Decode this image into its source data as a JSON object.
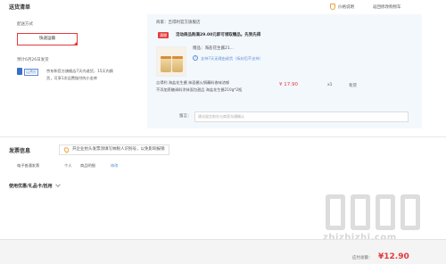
{
  "header": {
    "title": "送货清单",
    "price_help": "价格说明",
    "back_to_cart": "返回修改购物车"
  },
  "shipping": {
    "method_label": "配送方式",
    "method_chip": "快递运输",
    "eta": "预计6月26日发货",
    "tag": "运费险",
    "desc_line1": "京东和官方旗舰店7天内退货，15天内换",
    "desc_line2": "货，可享1次运费赔付的小金库"
  },
  "order": {
    "store_prefix": "商家：",
    "store_name": "吉得利官方旗舰店",
    "promo_tag": "满赠",
    "promo_text": "活动商品购满29.00元即可领取赠品。先到先得",
    "gift_label": "赠品：",
    "gift_name": "海盐花生酱21...",
    "service_tag": "7",
    "service_text": "支持7天无理由退货（拆封后不支持）",
    "product_title_line1": "吉得利 海盐花生酱 抹面酱火锅蘸料香味浓郁",
    "product_title_line2": "不添加蔗糖调料涂抹面包甜品 海盐花生酱210g*2瓶",
    "price": "¥ 17.90",
    "qty": "x1",
    "stock": "有货",
    "note_label": "留言：",
    "note_placeholder": "建议留言前先与商家沟通确认"
  },
  "invoice": {
    "title": "发票信息",
    "notice": "开企业抬头发票须填写纳税人识别号，以免影响报销",
    "type": "电子普通发票",
    "holder": "个人",
    "content": "商品明细",
    "edit": "修改"
  },
  "discount": {
    "title": "使用优惠/礼品卡/抵用"
  },
  "footer": {
    "total_label": "应付总额：",
    "total": "¥12.90"
  },
  "watermark": {
    "text": "zhizhizhi.com"
  },
  "colors": {
    "accent_red": "#e4393c",
    "link_blue": "#5b8bd6",
    "panel_blue": "#f3f8fd"
  }
}
